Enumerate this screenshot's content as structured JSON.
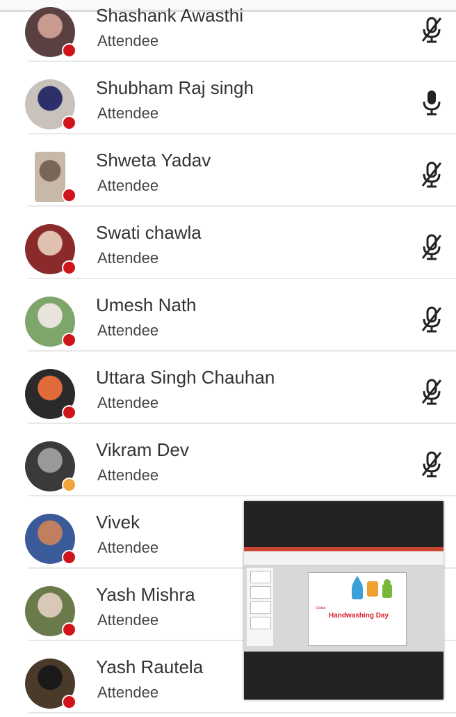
{
  "attendees": [
    {
      "name": "Shashank Awasthi",
      "role": "Attendee",
      "status_color": "#d0141c",
      "avatar_bg": "#5a4040",
      "avatar_fg": "#c89a90",
      "mic": "muted"
    },
    {
      "name": "Shubham Raj singh",
      "role": "Attendee",
      "status_color": "#d0141c",
      "avatar_bg": "#c9c2bc",
      "avatar_fg": "#2c2f6a",
      "mic": "on"
    },
    {
      "name": "Shweta Yadav",
      "role": "Attendee",
      "status_color": "#d0141c",
      "avatar_bg": "#c8b8a8",
      "avatar_fg": "#7a6658",
      "mic": "muted"
    },
    {
      "name": "Swati chawla",
      "role": "Attendee",
      "status_color": "#d0141c",
      "avatar_bg": "#8a2a2a",
      "avatar_fg": "#e0c0b0",
      "mic": "muted"
    },
    {
      "name": "Umesh Nath",
      "role": "Attendee",
      "status_color": "#d0141c",
      "avatar_bg": "#7fa66a",
      "avatar_fg": "#e8e4dc",
      "mic": "muted"
    },
    {
      "name": "Uttara Singh Chauhan",
      "role": "Attendee",
      "status_color": "#d0141c",
      "avatar_bg": "#2a2a2a",
      "avatar_fg": "#e06a3a",
      "mic": "muted"
    },
    {
      "name": "Vikram Dev",
      "role": "Attendee",
      "status_color": "#f2a43a",
      "avatar_bg": "#3a3a3a",
      "avatar_fg": "#9a9a9a",
      "mic": "muted"
    },
    {
      "name": "Vivek",
      "role": "Attendee",
      "status_color": "#d0141c",
      "avatar_bg": "#3a5a9a",
      "avatar_fg": "#c08060",
      "mic": "muted"
    },
    {
      "name": "Yash Mishra",
      "role": "Attendee",
      "status_color": "#d0141c",
      "avatar_bg": "#6a7a4a",
      "avatar_fg": "#d8c8b8",
      "mic": "muted"
    },
    {
      "name": "Yash Rautela",
      "role": "Attendee",
      "status_color": "#d0141c",
      "avatar_bg": "#4a3a2a",
      "avatar_fg": "#1a1a1a",
      "mic": "muted"
    }
  ],
  "pip": {
    "slide_small_text": "Global",
    "slide_title": "Handwashing Day"
  }
}
